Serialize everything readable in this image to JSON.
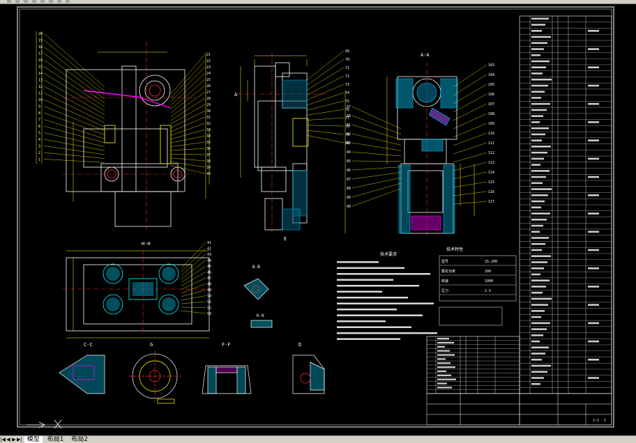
{
  "window": {
    "toolbar_icons": [
      "zoom-icon",
      "pan-icon",
      "layer-icon",
      "properties-icon",
      "save-icon",
      "print-icon",
      "undo-icon",
      "redo-icon"
    ]
  },
  "drawing": {
    "section_labels": {
      "aa": "A-A",
      "bb": "B-B",
      "cc": "C-C",
      "dd": "D",
      "ee": "E",
      "ff": "F-F",
      "gg": "G",
      "hh": "H-H",
      "kk": "K-K"
    },
    "view_markers": {
      "a": "A",
      "h": "H"
    },
    "balloons_left": [
      "20",
      "19",
      "18",
      "17",
      "16",
      "15",
      "14",
      "13",
      "12",
      "11",
      "10",
      "9",
      "8",
      "7",
      "6",
      "5",
      "4",
      "3",
      "2",
      "1"
    ],
    "balloons_left_right": [
      "21",
      "22",
      "23",
      "24",
      "25",
      "26",
      "27",
      "28",
      "29",
      "30",
      "31",
      "32",
      "33",
      "34",
      "35",
      "36",
      "37",
      "38",
      "39",
      "40"
    ],
    "balloons_mid_right": [
      "69",
      "70",
      "71",
      "72",
      "73",
      "74",
      "75",
      "76",
      "77",
      "78",
      "79",
      "80"
    ],
    "balloons_right_view_left": [
      "67",
      "68",
      "81",
      "82",
      "83",
      "84",
      "85",
      "86",
      "87",
      "88",
      "89",
      "90"
    ],
    "balloons_right_view_right": [
      "103",
      "104",
      "105",
      "106",
      "107",
      "108",
      "109",
      "110",
      "111",
      "112",
      "113",
      "114",
      "115",
      "116",
      "117"
    ],
    "balloons_plan_right": [
      "41",
      "42",
      "43",
      "44",
      "45",
      "46",
      "47",
      "48",
      "49",
      "50",
      "51",
      "52",
      "53"
    ],
    "notes_title": "技术要求",
    "spec_title": "技术特性",
    "spec_rows": [
      [
        "型号",
        "ZS-200"
      ],
      [
        "额定功率",
        "200"
      ],
      [
        "转速",
        "1000"
      ],
      [
        "压力",
        "2.5"
      ]
    ]
  },
  "title_block": {
    "company": "",
    "drawing_name": "",
    "scale": "1:1",
    "sheet": "1"
  },
  "status": {
    "ucs_x": "X",
    "ucs_y": "Y"
  },
  "layout_tabs": {
    "nav": [
      "|◀",
      "◀",
      "▶",
      "▶|"
    ],
    "model": "模型",
    "layout1": "布局1",
    "layout2": "布局2"
  },
  "colors": {
    "background": "#000000",
    "outline": "#ffffff",
    "dim": "#ffff00",
    "section": "#00ffff",
    "hatch": "#00c0ff",
    "accent": "#ff00ff",
    "red": "#ff3030",
    "green": "#00ff00"
  }
}
